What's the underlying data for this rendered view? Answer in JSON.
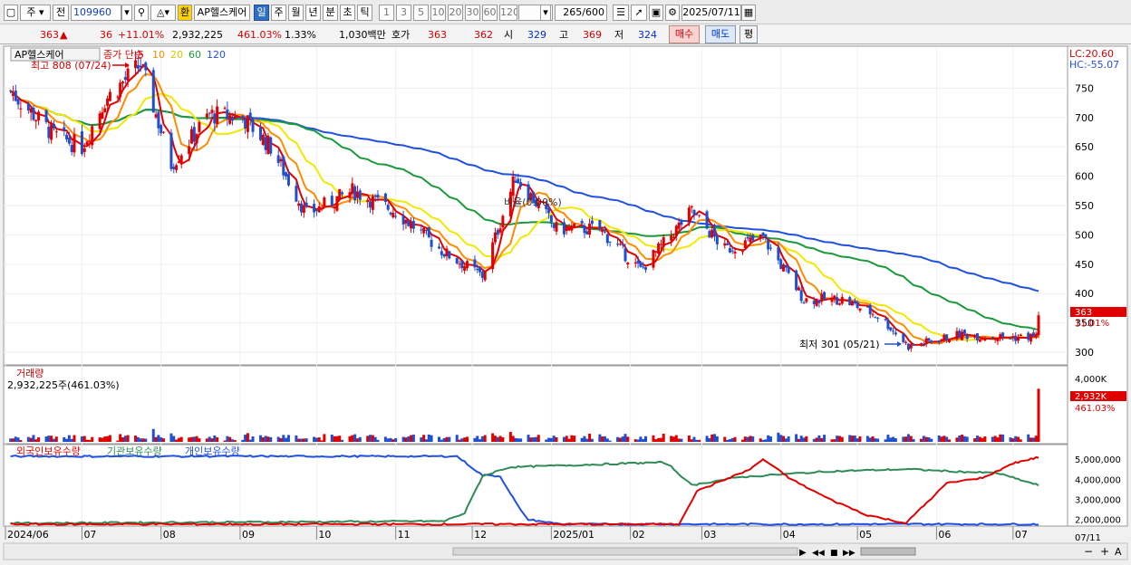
{
  "toolbar": {
    "type_select": "주",
    "prev_label": "전",
    "code": "109960",
    "name_button": "AP헬스케어",
    "exchange_badge": "환",
    "periods": [
      "일",
      "주",
      "월",
      "년",
      "분",
      "초",
      "틱"
    ],
    "active_period": "일",
    "intervals": [
      "1",
      "3",
      "5",
      "10",
      "20",
      "30",
      "60",
      "120"
    ],
    "count": "265",
    "count_total": "/600",
    "date": "2025/07/11"
  },
  "quote": {
    "price": "363",
    "change": "36",
    "change_pct": "+11.01%",
    "volume": "2,932,225",
    "volume_pct": "461.03%",
    "turnover": "1.33%",
    "amount": "1,030백만",
    "ask_label": "호가",
    "ask": "363",
    "bid": "362",
    "open_label": "시",
    "open": "329",
    "high_label": "고",
    "high": "369",
    "low_label": "저",
    "low": "324",
    "buy_label": "매수",
    "sell_label": "매도",
    "eval_label": "평"
  },
  "colors": {
    "up": "#e00000",
    "down": "#1f4fd0",
    "ma5": "#e00000",
    "ma10": "#ff8c00",
    "ma20": "#f2e800",
    "ma60": "#1a9a3a",
    "ma120": "#2050e0",
    "foreign": "#e00000",
    "institution": "#2e8b57",
    "individual": "#2050e0"
  },
  "chart_data": [
    {
      "type": "candlestick",
      "title": "AP헬스케어",
      "indicator_label": "종가 단순",
      "ma_periods": [
        "5",
        "10",
        "20",
        "60",
        "120"
      ],
      "ylim": [
        280,
        820
      ],
      "yticks": [
        300,
        350,
        400,
        450,
        500,
        550,
        600,
        650,
        700,
        750
      ],
      "xticks": [
        "2024/06",
        "07",
        "08",
        "09",
        "10",
        "11",
        "12",
        "2025/01",
        "02",
        "03",
        "04",
        "05",
        "06",
        "07"
      ],
      "right_top": [
        "LC:20.60",
        "HC:-55.07"
      ],
      "last_price_label": "363",
      "last_change_label": "11.01%",
      "annotations": {
        "high": "최고 808 (07/24)",
        "low": "최저 301 (05/21)",
        "mid": "비율(0.00%)"
      },
      "close_approx": [
        {
          "date": "2024/06/03",
          "close": 745
        },
        {
          "date": "2024/06/20",
          "close": 670
        },
        {
          "date": "2024/07/01",
          "close": 650
        },
        {
          "date": "2024/07/10",
          "close": 730
        },
        {
          "date": "2024/07/24",
          "close": 790
        },
        {
          "date": "2024/08/05",
          "close": 620
        },
        {
          "date": "2024/08/20",
          "close": 705
        },
        {
          "date": "2024/09/02",
          "close": 700
        },
        {
          "date": "2024/09/13",
          "close": 650
        },
        {
          "date": "2024/09/27",
          "close": 535
        },
        {
          "date": "2024/10/15",
          "close": 575
        },
        {
          "date": "2024/11/01",
          "close": 540
        },
        {
          "date": "2024/11/20",
          "close": 470
        },
        {
          "date": "2024/12/05",
          "close": 430
        },
        {
          "date": "2024/12/18",
          "close": 600
        },
        {
          "date": "2025/01/03",
          "close": 510
        },
        {
          "date": "2025/01/20",
          "close": 510
        },
        {
          "date": "2025/02/05",
          "close": 440
        },
        {
          "date": "2025/02/25",
          "close": 540
        },
        {
          "date": "2025/03/10",
          "close": 475
        },
        {
          "date": "2025/03/25",
          "close": 495
        },
        {
          "date": "2025/04/10",
          "close": 390
        },
        {
          "date": "2025/04/25",
          "close": 390
        },
        {
          "date": "2025/05/10",
          "close": 360
        },
        {
          "date": "2025/05/21",
          "close": 310
        },
        {
          "date": "2025/06/10",
          "close": 330
        },
        {
          "date": "2025/06/30",
          "close": 325
        },
        {
          "date": "2025/07/10",
          "close": 327
        },
        {
          "date": "2025/07/11",
          "close": 363
        }
      ]
    },
    {
      "type": "bar",
      "title": "거래량",
      "subtitle": "2,932,225주(461.03%)",
      "ylim": [
        0,
        4000000
      ],
      "yticks_label": [
        "4,000K"
      ],
      "last_value_label": "2,932K",
      "last_pct_label": "461.03%"
    },
    {
      "type": "line",
      "series": [
        {
          "name": "외국인보유수량"
        },
        {
          "name": "기관보유수량"
        },
        {
          "name": "개인보유수량"
        }
      ],
      "yticks_label": [
        "5,000,000",
        "4,000,000",
        "3,000,000",
        "2,000,000"
      ],
      "ylim": [
        1700000,
        5600000
      ],
      "date_label": "07/11"
    }
  ],
  "nav_buttons": [
    "▶",
    "◀◀",
    "■",
    "▶▶"
  ]
}
